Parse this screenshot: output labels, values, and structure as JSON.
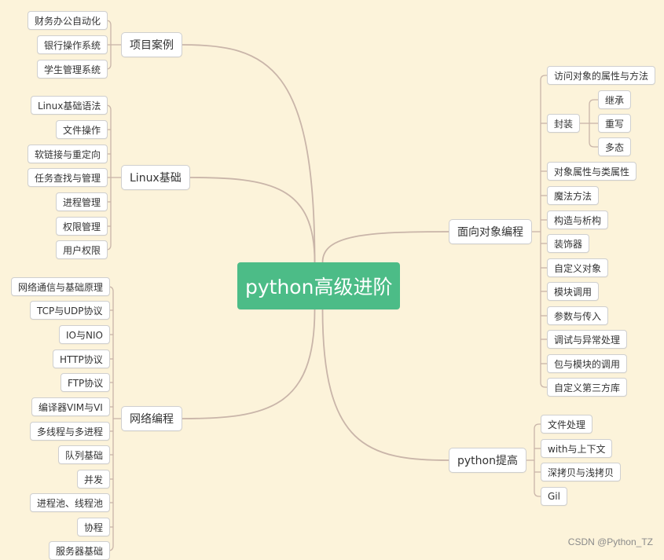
{
  "root": {
    "label": "python高级进阶"
  },
  "branches": {
    "projects": {
      "label": "项目案例",
      "items": [
        "财务办公自动化",
        "银行操作系统",
        "学生管理系统"
      ]
    },
    "linux": {
      "label": "Linux基础",
      "items": [
        "Linux基础语法",
        "文件操作",
        "软链接与重定向",
        "任务查找与管理",
        "进程管理",
        "权限管理",
        "用户权限"
      ]
    },
    "network": {
      "label": "网络编程",
      "items": [
        "网络通信与基础原理",
        "TCP与UDP协议",
        "IO与NIO",
        "HTTP协议",
        "FTP协议",
        "编译器VIM与VI",
        "多线程与多进程",
        "队列基础",
        "并发",
        "进程池、线程池",
        "协程",
        "服务器基础"
      ]
    },
    "oop": {
      "label": "面向对象编程",
      "items": [
        "访问对象的属性与方法",
        "封装",
        "对象属性与类属性",
        "魔法方法",
        "构造与析构",
        "装饰器",
        "自定义对象",
        "模块调用",
        "参数与传入",
        "调试与异常处理",
        "包与模块的调用",
        "自定义第三方库"
      ],
      "encapsulation_children": [
        "继承",
        "重写",
        "多态"
      ]
    },
    "advanced": {
      "label": "python提高",
      "items": [
        "文件处理",
        "with与上下文",
        "深拷贝与浅拷贝",
        "Gil"
      ]
    }
  },
  "watermark": "CSDN @Python_TZ",
  "colors": {
    "background": "#fcf3da",
    "root": "#4cbc87",
    "line": "#c9b5a9",
    "node_border": "#cfcfcf"
  }
}
